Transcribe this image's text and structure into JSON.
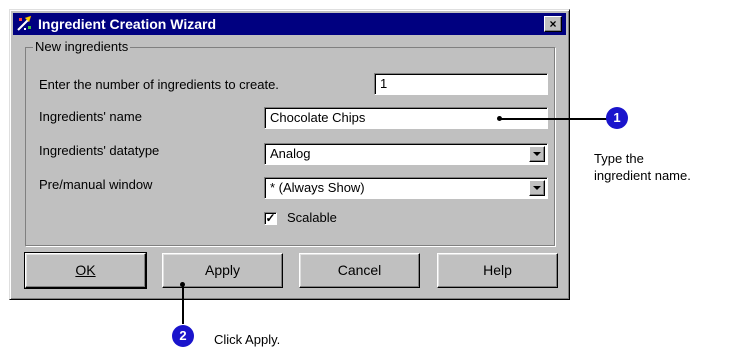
{
  "window": {
    "title": "Ingredient Creation Wizard",
    "close_label": "×"
  },
  "group": {
    "legend": "New ingredients"
  },
  "form": {
    "count_label": "Enter the number of ingredients to create.",
    "count_value": "1",
    "name_label": "Ingredients' name",
    "name_value": "Chocolate Chips",
    "datatype_label": "Ingredients' datatype",
    "datatype_value": "Analog",
    "window_label": "Pre/manual window",
    "window_value": "* (Always Show)",
    "scalable_label": "Scalable",
    "scalable_checked": true,
    "check_mark": "✓"
  },
  "buttons": {
    "ok": "OK",
    "apply": "Apply",
    "cancel": "Cancel",
    "help": "Help"
  },
  "callouts": [
    {
      "number": "1",
      "text_line1": "Type the",
      "text_line2": "ingredient name."
    },
    {
      "number": "2",
      "text": "Click Apply."
    }
  ],
  "colors": {
    "titlebar": "#000080",
    "dialog_face": "#c0c0c0",
    "callout_circle": "#1a14cc"
  }
}
